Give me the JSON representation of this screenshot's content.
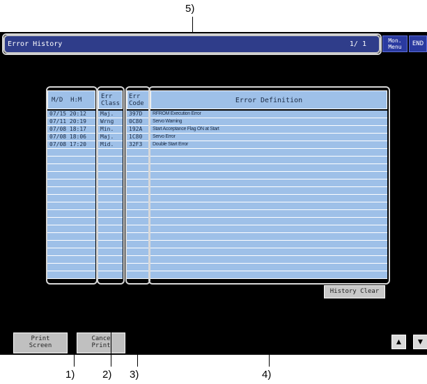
{
  "screen": {
    "title": "Error History",
    "page_indicator": "1/ 1",
    "mon_menu_label": "Mon.\nMenu",
    "end_label": "END"
  },
  "table": {
    "headers": {
      "datetime": "M/D  H:M",
      "err_class": "Err\nClass",
      "err_code": "Err\nCode",
      "definition": "Error Definition"
    },
    "rows": [
      {
        "datetime": "07/15 20:12",
        "err_class": "Maj.",
        "err_code": "397D",
        "definition": "RFROM Execution Error"
      },
      {
        "datetime": "07/11 20:19",
        "err_class": "Wrng",
        "err_code": "0C80",
        "definition": "Servo Warning"
      },
      {
        "datetime": "07/08 18:17",
        "err_class": "Min.",
        "err_code": "192A",
        "definition": "Start Acceptance Flag ON at Start"
      },
      {
        "datetime": "07/08 18:06",
        "err_class": "Maj.",
        "err_code": "1C80",
        "definition": "Servo Error"
      },
      {
        "datetime": "07/08 17:20",
        "err_class": "Mid.",
        "err_code": "32F3",
        "definition": "Double Start Error"
      },
      {
        "datetime": "",
        "err_class": "",
        "err_code": "",
        "definition": ""
      },
      {
        "datetime": "",
        "err_class": "",
        "err_code": "",
        "definition": ""
      },
      {
        "datetime": "",
        "err_class": "",
        "err_code": "",
        "definition": ""
      },
      {
        "datetime": "",
        "err_class": "",
        "err_code": "",
        "definition": ""
      },
      {
        "datetime": "",
        "err_class": "",
        "err_code": "",
        "definition": ""
      },
      {
        "datetime": "",
        "err_class": "",
        "err_code": "",
        "definition": ""
      },
      {
        "datetime": "",
        "err_class": "",
        "err_code": "",
        "definition": ""
      },
      {
        "datetime": "",
        "err_class": "",
        "err_code": "",
        "definition": ""
      },
      {
        "datetime": "",
        "err_class": "",
        "err_code": "",
        "definition": ""
      },
      {
        "datetime": "",
        "err_class": "",
        "err_code": "",
        "definition": ""
      },
      {
        "datetime": "",
        "err_class": "",
        "err_code": "",
        "definition": ""
      },
      {
        "datetime": "",
        "err_class": "",
        "err_code": "",
        "definition": ""
      },
      {
        "datetime": "",
        "err_class": "",
        "err_code": "",
        "definition": ""
      },
      {
        "datetime": "",
        "err_class": "",
        "err_code": "",
        "definition": ""
      },
      {
        "datetime": "",
        "err_class": "",
        "err_code": "",
        "definition": ""
      },
      {
        "datetime": "",
        "err_class": "",
        "err_code": "",
        "definition": ""
      },
      {
        "datetime": "",
        "err_class": "",
        "err_code": "",
        "definition": ""
      }
    ]
  },
  "buttons": {
    "history_clear": "History Clear",
    "print_screen": "Print\nScreen",
    "cancel_print": "Cance\nPrint"
  },
  "icons": {
    "up": "up-arrow-icon",
    "down": "down-arrow-icon"
  },
  "callouts": {
    "c1": "1)",
    "c2": "2)",
    "c3": "3)",
    "c4": "4)",
    "c5": "5)"
  },
  "colors": {
    "title_bar": "#2f3d8a",
    "table_cell": "#9ec0e8",
    "screen_bg": "#000000"
  }
}
